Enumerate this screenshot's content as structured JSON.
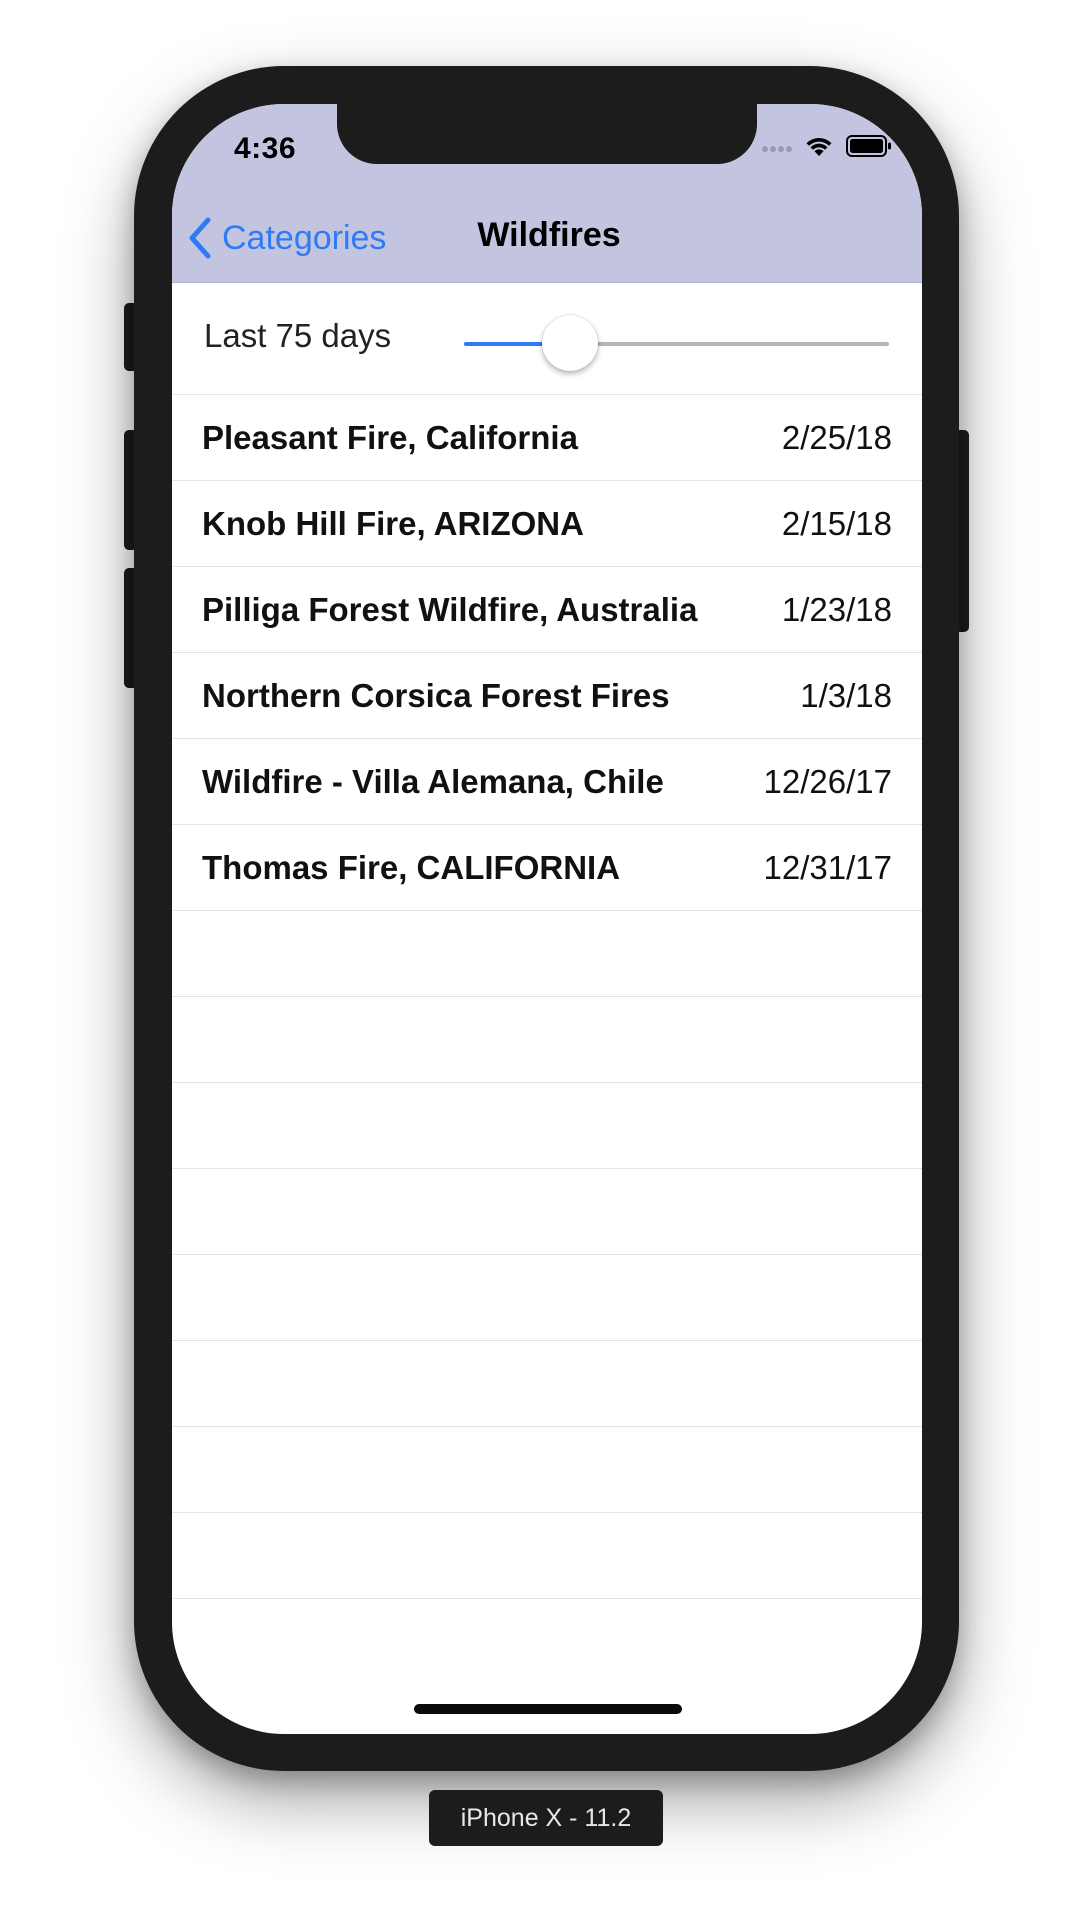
{
  "status_bar": {
    "time": "4:36",
    "icons": [
      "signal-icon",
      "wifi-icon",
      "battery-icon"
    ]
  },
  "nav": {
    "back_label": "Categories",
    "title": "Wildfires",
    "background": "#c3c5e0",
    "accent": "#2f7bf5"
  },
  "filter": {
    "label": "Last 75 days",
    "slider_fraction": 0.25
  },
  "events": [
    {
      "name": "Pleasant Fire, California",
      "date": "2/25/18"
    },
    {
      "name": "Knob Hill Fire, ARIZONA",
      "date": "2/15/18"
    },
    {
      "name": "Pilliga Forest Wildfire, Australia",
      "date": "1/23/18"
    },
    {
      "name": "Northern Corsica Forest Fires",
      "date": "1/3/18"
    },
    {
      "name": "Wildfire - Villa Alemana, Chile",
      "date": "12/26/17"
    },
    {
      "name": "Thomas Fire, CALIFORNIA",
      "date": "12/31/17"
    }
  ],
  "device_label": "iPhone X - 11.2"
}
